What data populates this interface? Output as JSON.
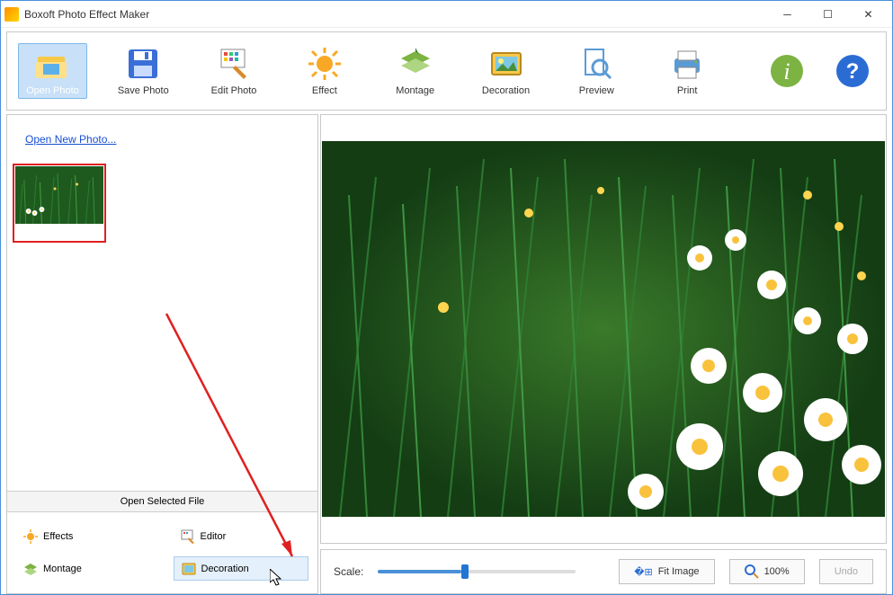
{
  "titlebar": {
    "title": "Boxoft Photo Effect Maker"
  },
  "toolbar": {
    "open_photo": "Open Photo",
    "save_photo": "Save Photo",
    "edit_photo": "Edit Photo",
    "effect": "Effect",
    "montage": "Montage",
    "decoration": "Decoration",
    "preview": "Preview",
    "print": "Print"
  },
  "sidebar": {
    "open_new_link": "Open New Photo...",
    "open_selected": "Open Selected File"
  },
  "tabs": {
    "effects": "Effects",
    "editor": "Editor",
    "montage": "Montage",
    "decoration": "Decoration"
  },
  "statusbar": {
    "scale_label": "Scale:",
    "fit_image": "Fit Image",
    "zoom_100": "100%",
    "undo": "Undo"
  }
}
